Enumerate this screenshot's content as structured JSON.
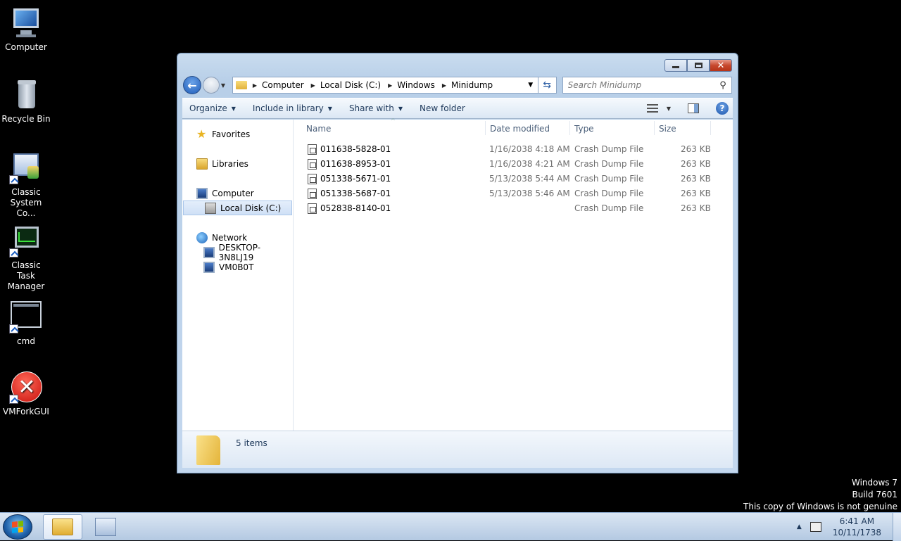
{
  "desktop": {
    "icons": [
      {
        "label": "Computer"
      },
      {
        "label": "Recycle Bin"
      },
      {
        "label": "Classic System Co..."
      },
      {
        "label": "Classic Task Manager"
      },
      {
        "label": "cmd"
      },
      {
        "label": "VMForkGUI"
      }
    ]
  },
  "window": {
    "controls": {
      "close_glyph": "✕"
    },
    "address": {
      "crumbs": [
        "Computer",
        "Local Disk (C:)",
        "Windows",
        "Minidump"
      ]
    },
    "search": {
      "placeholder": "Search Minidump"
    },
    "toolbar": {
      "organize": "Organize",
      "include": "Include in library",
      "share": "Share with",
      "new_folder": "New folder",
      "help_glyph": "?"
    },
    "navpane": {
      "favorites": "Favorites",
      "libraries": "Libraries",
      "computer": "Computer",
      "local_disk": "Local Disk (C:)",
      "network": "Network",
      "desktop_pc": "DESKTOP-3N8LJ19",
      "vm": "VM0B0T"
    },
    "columns": {
      "name": "Name",
      "date": "Date modified",
      "type": "Type",
      "size": "Size"
    },
    "files": [
      {
        "name": "011638-5828-01",
        "date": "1/16/2038 4:18 AM",
        "type": "Crash Dump File",
        "size": "263 KB"
      },
      {
        "name": "011638-8953-01",
        "date": "1/16/2038 4:21 AM",
        "type": "Crash Dump File",
        "size": "263 KB"
      },
      {
        "name": "051338-5671-01",
        "date": "5/13/2038 5:44 AM",
        "type": "Crash Dump File",
        "size": "263 KB"
      },
      {
        "name": "051338-5687-01",
        "date": "5/13/2038 5:46 AM",
        "type": "Crash Dump File",
        "size": "263 KB"
      },
      {
        "name": "052838-8140-01",
        "date": "",
        "type": "Crash Dump File",
        "size": "263 KB"
      }
    ],
    "status": {
      "items": "5 items"
    }
  },
  "watermark": {
    "line1": "Windows 7",
    "line2": "Build 7601",
    "line3": "This copy of Windows is not genuine"
  },
  "taskbar": {
    "time": "6:41 AM",
    "date": "10/11/1738"
  }
}
